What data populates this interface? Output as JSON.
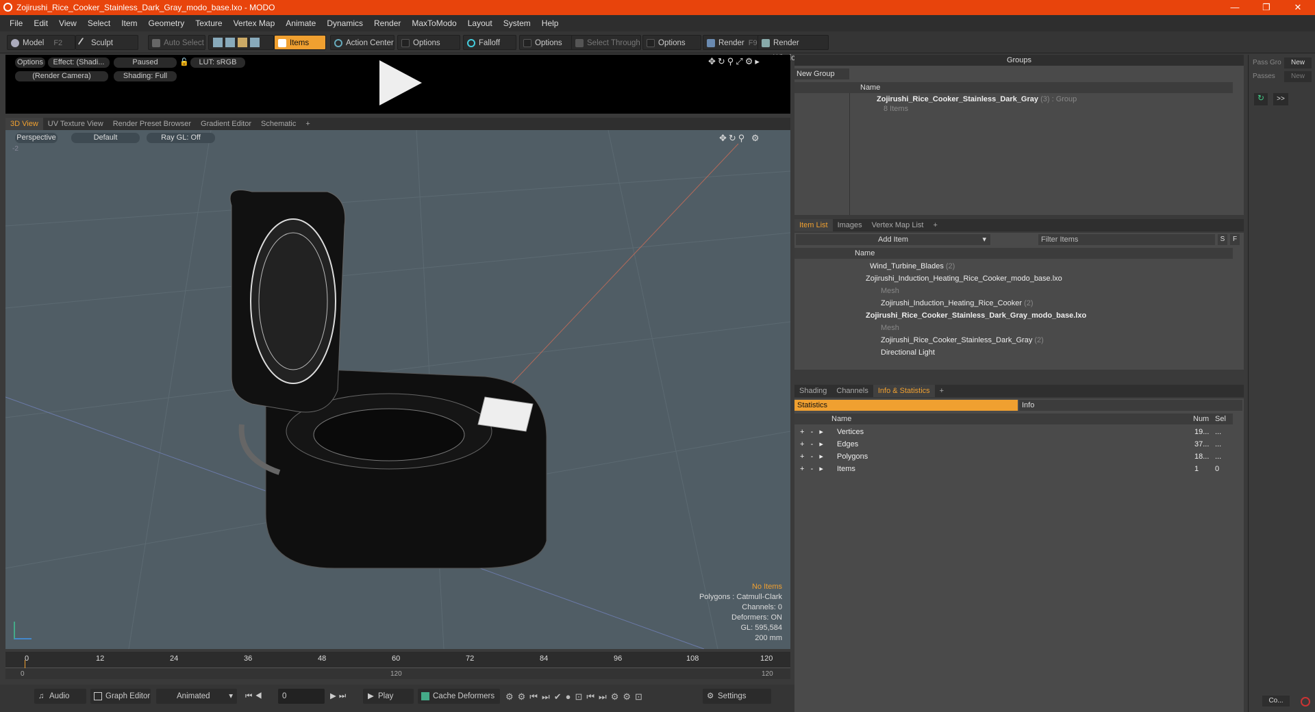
{
  "window": {
    "title": "Zojirushi_Rice_Cooker_Stainless_Dark_Gray_modo_base.lxo - MODO",
    "min": "—",
    "max": "❐",
    "close": "✕"
  },
  "menu": [
    "File",
    "Edit",
    "View",
    "Select",
    "Item",
    "Geometry",
    "Texture",
    "Vertex Map",
    "Animate",
    "Dynamics",
    "Render",
    "MaxToModo",
    "Layout",
    "System",
    "Help"
  ],
  "toolbar": {
    "model": "Model",
    "model_key": "F2",
    "sculpt": "Sculpt",
    "auto_select": "Auto Select",
    "items": "Items",
    "action_center": "Action Center",
    "options1": "Options",
    "falloff": "Falloff",
    "options2": "Options",
    "select_through": "Select Through",
    "options3": "Options",
    "render": "Render",
    "render_key": "F9",
    "render_window": "Render Window"
  },
  "preview": {
    "options": "Options",
    "effect": "Effect: (Shadi...",
    "paused": "Paused",
    "lut": "LUT: sRGB",
    "camera": "(Render Camera)",
    "shading": "Shading: Full"
  },
  "view_tabs": [
    "3D View",
    "UV Texture View",
    "Render Preset Browser",
    "Gradient Editor",
    "Schematic",
    "+"
  ],
  "viewport": {
    "perspective": "Perspective",
    "default": "Default",
    "raygl": "Ray GL: Off",
    "axis_num": "-2",
    "info": {
      "no_items": "No Items",
      "polygons": "Polygons : Catmull-Clark",
      "channels": "Channels: 0",
      "deformers": "Deformers: ON",
      "gl": "GL: 595,584",
      "scale": "200 mm"
    }
  },
  "timeline": {
    "ticks": [
      "0",
      "12",
      "24",
      "36",
      "48",
      "60",
      "72",
      "84",
      "96",
      "108",
      "120"
    ],
    "sub_left": "0",
    "sub_mid": "120",
    "sub_right": "120"
  },
  "bottom": {
    "audio": "Audio",
    "graph_editor": "Graph Editor",
    "animated": "Animated",
    "frame": "0",
    "play": "Play",
    "cache": "Cache Deformers",
    "settings": "Settings"
  },
  "groups": {
    "title": "Groups",
    "new_group": "New Group",
    "col_name": "Name",
    "item_name": "Zojirushi_Rice_Cooker_Stainless_Dark_Gray",
    "item_count": "(3)",
    "item_type": ": Group",
    "item_sub": "8 Items"
  },
  "side": {
    "pass_group": "Pass Gro",
    "new1": "New",
    "passes": "Passes",
    "new2": "New",
    "arrows": ">>",
    "bottom": "Co..."
  },
  "item_list": {
    "tabs": [
      "Item List",
      "Images",
      "Vertex Map List",
      "+"
    ],
    "add_item": "Add Item",
    "filter": "Filter Items",
    "s": "S",
    "f": "F",
    "col_name": "Name",
    "rows": [
      {
        "name": "Wind_Turbine_Blades",
        "count": "(2)"
      },
      {
        "name": "Zojirushi_Induction_Heating_Rice_Cooker_modo_base.lxo",
        "count": ""
      },
      {
        "name": "Mesh",
        "count": ""
      },
      {
        "name": "Zojirushi_Induction_Heating_Rice_Cooker",
        "count": "(2)"
      },
      {
        "name": "Zojirushi_Rice_Cooker_Stainless_Dark_Gray_modo_base.lxo",
        "count": ""
      },
      {
        "name": "Mesh",
        "count": ""
      },
      {
        "name": "Zojirushi_Rice_Cooker_Stainless_Dark_Gray",
        "count": "(2)"
      },
      {
        "name": "Directional Light",
        "count": ""
      }
    ]
  },
  "info_panel": {
    "tabs": [
      "Shading",
      "Channels",
      "Info & Statistics",
      "+"
    ],
    "statistics": "Statistics",
    "info": "Info",
    "cols": {
      "name": "Name",
      "num": "Num",
      "sel": "Sel"
    },
    "rows": [
      {
        "name": "Vertices",
        "num": "19...",
        "sel": "..."
      },
      {
        "name": "Edges",
        "num": "37...",
        "sel": "..."
      },
      {
        "name": "Polygons",
        "num": "18...",
        "sel": "..."
      },
      {
        "name": "Items",
        "num": "1",
        "sel": "0"
      }
    ]
  },
  "colors": {
    "accent": "#f0a030",
    "titlebar": "#e8440c"
  }
}
